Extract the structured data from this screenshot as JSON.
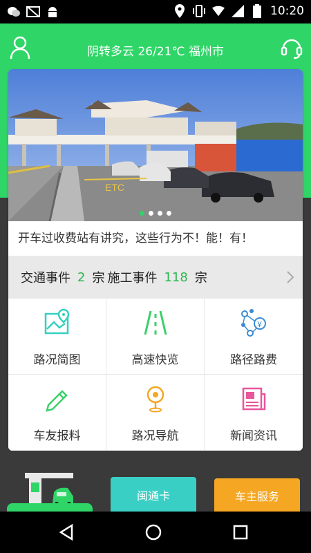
{
  "status_bar": {
    "time": "10:20",
    "left_icons": [
      "wechat-icon",
      "image-off-icon",
      "android-icon"
    ],
    "right_icons": [
      "location-icon",
      "vibrate-icon",
      "wifi-icon",
      "signal-icon",
      "battery-icon"
    ]
  },
  "header": {
    "weather": "阴转多云 26/21℃ 福州市",
    "left_icon": "user-icon",
    "right_icon": "headset-icon"
  },
  "banner": {
    "alt": "ETC",
    "dots": [
      true,
      false,
      false,
      false
    ]
  },
  "headline": "开车过收费站有讲究，这些行为不！能！有！",
  "events": {
    "traffic_label": "交通事件",
    "traffic_count": "2",
    "unit1": "宗",
    "construction_label": "施工事件",
    "construction_count": "118",
    "unit2": "宗"
  },
  "grid": [
    {
      "label": "路况简图",
      "icon": "map-icon"
    },
    {
      "label": "高速快览",
      "icon": "road-icon"
    },
    {
      "label": "路径路费",
      "icon": "route-fee-icon"
    },
    {
      "label": "车友报料",
      "icon": "pencil-icon"
    },
    {
      "label": "路况导航",
      "icon": "navigation-pin-icon"
    },
    {
      "label": "新闻资讯",
      "icon": "newspaper-icon"
    }
  ],
  "bottom": {
    "mintong_label": "闽通卡",
    "owner_label": "车主服务"
  },
  "colors": {
    "green": "#2fd567",
    "teal": "#39cfc5",
    "orange": "#f5a623",
    "count_green": "#2bb54f"
  }
}
